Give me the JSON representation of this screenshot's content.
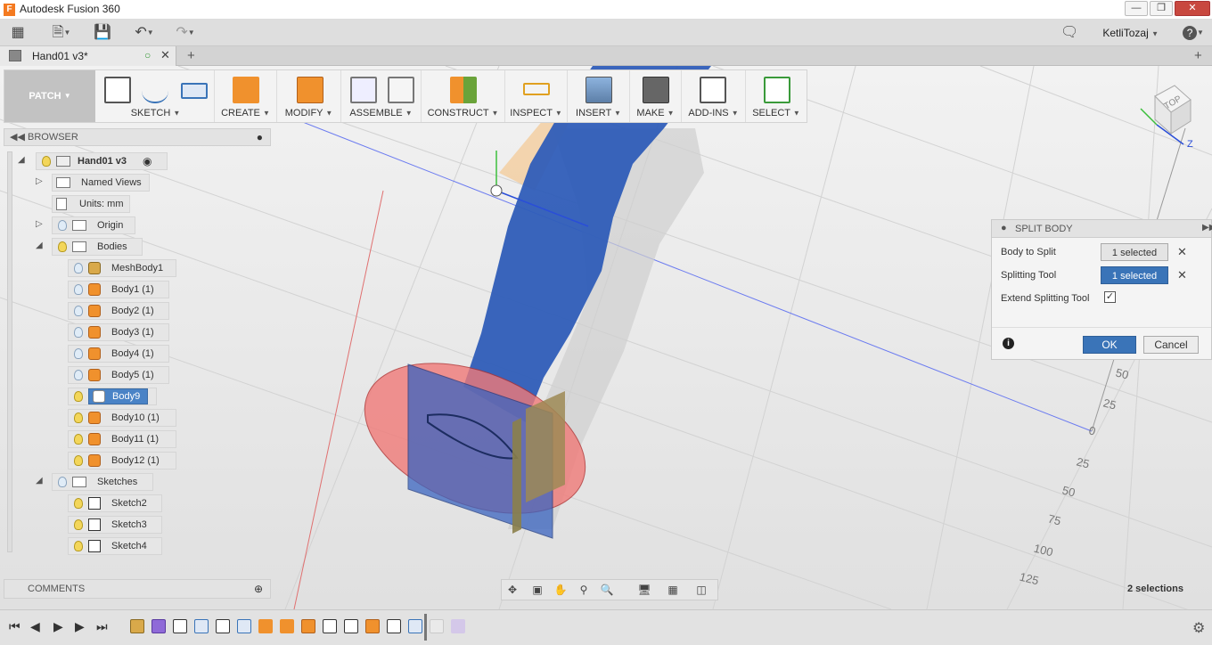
{
  "app": {
    "title": "Autodesk Fusion 360",
    "icon_letter": "F",
    "window_buttons": [
      "minimize-icon",
      "maximize-icon",
      "close-icon"
    ]
  },
  "quick_access": {
    "user": "KetliTozaj",
    "help": "?"
  },
  "document_tab": {
    "name": "Hand01 v3*"
  },
  "toolbar": {
    "workspace": "PATCH",
    "groups": [
      {
        "label": "SKETCH"
      },
      {
        "label": "CREATE"
      },
      {
        "label": "MODIFY"
      },
      {
        "label": "ASSEMBLE"
      },
      {
        "label": "CONSTRUCT"
      },
      {
        "label": "INSPECT"
      },
      {
        "label": "INSERT"
      },
      {
        "label": "MAKE"
      },
      {
        "label": "ADD-INS"
      },
      {
        "label": "SELECT"
      }
    ],
    "accent_orange": "#f0912d"
  },
  "browser": {
    "title": "BROWSER",
    "root": "Hand01 v3",
    "items": [
      {
        "label": "Named Views"
      },
      {
        "label": "Units: mm"
      },
      {
        "label": "Origin"
      },
      {
        "label": "Bodies"
      },
      {
        "label": "MeshBody1"
      },
      {
        "label": "Body1 (1)"
      },
      {
        "label": "Body2 (1)"
      },
      {
        "label": "Body3 (1)"
      },
      {
        "label": "Body4 (1)"
      },
      {
        "label": "Body5 (1)"
      },
      {
        "label": "Body9"
      },
      {
        "label": "Body10 (1)"
      },
      {
        "label": "Body11 (1)"
      },
      {
        "label": "Body12 (1)"
      },
      {
        "label": "Sketches"
      },
      {
        "label": "Sketch2"
      },
      {
        "label": "Sketch3"
      },
      {
        "label": "Sketch4"
      }
    ]
  },
  "comments": {
    "title": "COMMENTS"
  },
  "split_body": {
    "title": "SPLIT BODY",
    "body_to_split_label": "Body to Split",
    "body_to_split_value": "1 selected",
    "splitting_tool_label": "Splitting Tool",
    "splitting_tool_value": "1 selected",
    "extend_label": "Extend Splitting Tool",
    "extend_checked": true,
    "ok": "OK",
    "cancel": "Cancel",
    "accent_blue": "#3a74b8"
  },
  "viewcube": {
    "face": "TOP",
    "axis_z": "Z"
  },
  "axis_ticks": [
    "50",
    "25",
    "0",
    "25",
    "50",
    "75",
    "100",
    "125"
  ],
  "status": {
    "selections": "2 selections"
  }
}
